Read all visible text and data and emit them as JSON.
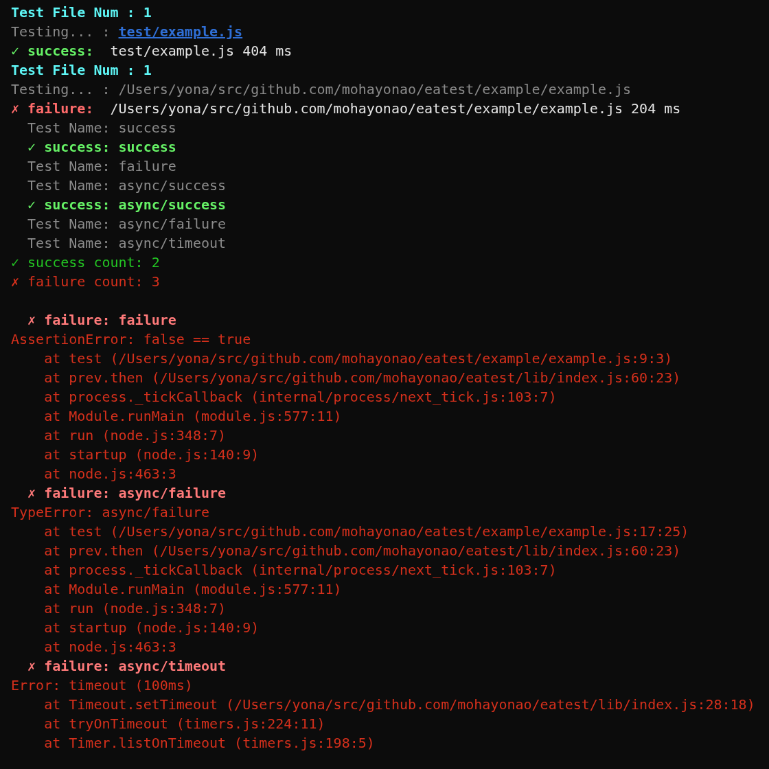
{
  "terminal": {
    "lines": [
      {
        "kind": "top",
        "parts": [
          {
            "kind": "header",
            "text": "Test File Num : 1"
          }
        ]
      },
      {
        "kind": "top",
        "parts": [
          {
            "kind": "muted",
            "text": "Testing... :"
          },
          {
            "kind": "link",
            "text": "test/example.js"
          }
        ]
      },
      {
        "kind": "top",
        "parts": [
          {
            "kind": "okbold",
            "text": "✓ success:"
          },
          {
            "kind": "plain",
            "text": " test/example.js 404 ms"
          }
        ]
      },
      {
        "kind": "top",
        "parts": [
          {
            "kind": "header",
            "text": "Test File Num : 1"
          }
        ]
      },
      {
        "kind": "top",
        "parts": [
          {
            "kind": "muted",
            "text": "Testing... : /Users/yona/src/github.com/mohayonao/eatest/example/example.js"
          }
        ]
      },
      {
        "kind": "top",
        "parts": [
          {
            "kind": "failbold",
            "text": "✗ failure:"
          },
          {
            "kind": "plain",
            "text": " /Users/yona/src/github.com/mohayonao/eatest/example/example.js 204 ms"
          }
        ]
      },
      {
        "kind": "nested",
        "parts": [
          {
            "kind": "name",
            "text": "Test Name: success"
          }
        ]
      },
      {
        "kind": "nested",
        "parts": [
          {
            "kind": "okbold",
            "text": "✓ success: success"
          }
        ]
      },
      {
        "kind": "nested",
        "parts": [
          {
            "kind": "name",
            "text": "Test Name: failure"
          }
        ]
      },
      {
        "kind": "nested",
        "parts": [
          {
            "kind": "name",
            "text": "Test Name: async/success"
          }
        ]
      },
      {
        "kind": "nested",
        "parts": [
          {
            "kind": "okbold",
            "text": "✓ success: async/success"
          }
        ]
      },
      {
        "kind": "nested",
        "parts": [
          {
            "kind": "name",
            "text": "Test Name: async/failure"
          }
        ]
      },
      {
        "kind": "nested",
        "parts": [
          {
            "kind": "name",
            "text": "Test Name: async/timeout"
          }
        ]
      },
      {
        "kind": "top",
        "parts": [
          {
            "kind": "ok",
            "text": "✓ success count: 2"
          }
        ]
      },
      {
        "kind": "top",
        "parts": [
          {
            "kind": "fail",
            "text": "✗ failure count: 3"
          }
        ]
      },
      {
        "kind": "blank"
      },
      {
        "kind": "nested",
        "parts": [
          {
            "kind": "failtitle",
            "text": "✗ failure: failure"
          }
        ]
      },
      {
        "kind": "top",
        "parts": [
          {
            "kind": "error",
            "text": "AssertionError: false == true"
          }
        ]
      },
      {
        "kind": "stack",
        "parts": [
          {
            "kind": "error",
            "text": "at test (/Users/yona/src/github.com/mohayonao/eatest/example/example.js:9:3)"
          }
        ]
      },
      {
        "kind": "stack",
        "parts": [
          {
            "kind": "error",
            "text": "at prev.then (/Users/yona/src/github.com/mohayonao/eatest/lib/index.js:60:23)"
          }
        ]
      },
      {
        "kind": "stack",
        "parts": [
          {
            "kind": "error",
            "text": "at process._tickCallback (internal/process/next_tick.js:103:7)"
          }
        ]
      },
      {
        "kind": "stack",
        "parts": [
          {
            "kind": "error",
            "text": "at Module.runMain (module.js:577:11)"
          }
        ]
      },
      {
        "kind": "stack",
        "parts": [
          {
            "kind": "error",
            "text": "at run (node.js:348:7)"
          }
        ]
      },
      {
        "kind": "stack",
        "parts": [
          {
            "kind": "error",
            "text": "at startup (node.js:140:9)"
          }
        ]
      },
      {
        "kind": "stack",
        "parts": [
          {
            "kind": "error",
            "text": "at node.js:463:3"
          }
        ]
      },
      {
        "kind": "nested",
        "parts": [
          {
            "kind": "failtitle",
            "text": "✗ failure: async/failure"
          }
        ]
      },
      {
        "kind": "top",
        "parts": [
          {
            "kind": "error",
            "text": "TypeError: async/failure"
          }
        ]
      },
      {
        "kind": "stack",
        "parts": [
          {
            "kind": "error",
            "text": "at test (/Users/yona/src/github.com/mohayonao/eatest/example/example.js:17:25)"
          }
        ]
      },
      {
        "kind": "stack",
        "parts": [
          {
            "kind": "error",
            "text": "at prev.then (/Users/yona/src/github.com/mohayonao/eatest/lib/index.js:60:23)"
          }
        ]
      },
      {
        "kind": "stack",
        "parts": [
          {
            "kind": "error",
            "text": "at process._tickCallback (internal/process/next_tick.js:103:7)"
          }
        ]
      },
      {
        "kind": "stack",
        "parts": [
          {
            "kind": "error",
            "text": "at Module.runMain (module.js:577:11)"
          }
        ]
      },
      {
        "kind": "stack",
        "parts": [
          {
            "kind": "error",
            "text": "at run (node.js:348:7)"
          }
        ]
      },
      {
        "kind": "stack",
        "parts": [
          {
            "kind": "error",
            "text": "at startup (node.js:140:9)"
          }
        ]
      },
      {
        "kind": "stack",
        "parts": [
          {
            "kind": "error",
            "text": "at node.js:463:3"
          }
        ]
      },
      {
        "kind": "nested",
        "parts": [
          {
            "kind": "failtitle",
            "text": "✗ failure: async/timeout"
          }
        ]
      },
      {
        "kind": "top",
        "parts": [
          {
            "kind": "error",
            "text": "Error: timeout (100ms)"
          }
        ]
      },
      {
        "kind": "stack",
        "parts": [
          {
            "kind": "error",
            "text": "at Timeout.setTimeout (/Users/yona/src/github.com/mohayonao/eatest/lib/index.js:28:18)"
          }
        ]
      },
      {
        "kind": "stack",
        "parts": [
          {
            "kind": "error",
            "text": "at tryOnTimeout (timers.js:224:11)"
          }
        ]
      },
      {
        "kind": "stack",
        "parts": [
          {
            "kind": "error",
            "text": "at Timer.listOnTimeout (timers.js:198:5)"
          }
        ]
      }
    ]
  }
}
